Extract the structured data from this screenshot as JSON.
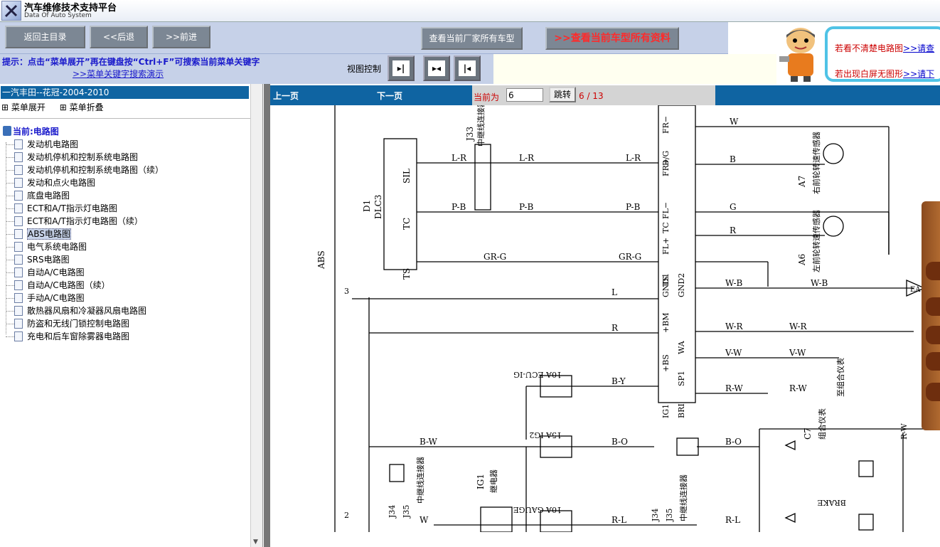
{
  "header": {
    "title": "汽车维修技术支持平台",
    "subtitle": "Data Of Auto System"
  },
  "toolbar": {
    "home_label": "返回主目录",
    "back_label": "<<后退",
    "forward_label": ">>前进",
    "all_models_label": "查看当前厂家所有车型",
    "all_data_label": ">>查看当前车型所有资料"
  },
  "hint": {
    "text": "提示：点击“菜单展开”再在键盘按“Ctrl+F”可搜索当前菜单关键字",
    "link": ">>菜单关键字搜索演示",
    "view_control": "视图控制"
  },
  "notices": {
    "line1_text": "若看不清楚电路图",
    "line1_link": ">>请查",
    "line2_text": "若出现白屏无图形",
    "line2_link": ">>请下"
  },
  "sidebar": {
    "car_title": "一汽丰田--花冠-2004-2010",
    "expand_label": "菜单展开",
    "collapse_label": "菜单折叠",
    "root_label": "当前:电路图",
    "items": [
      {
        "label": "发动机电路图"
      },
      {
        "label": "发动机停机和控制系统电路图"
      },
      {
        "label": "发动机停机和控制系统电路图（续）"
      },
      {
        "label": "发动和点火电路图"
      },
      {
        "label": "底盘电路图"
      },
      {
        "label": "ECT和A/T指示灯电路图"
      },
      {
        "label": "ECT和A/T指示灯电路图（续）"
      },
      {
        "label": "ABS电路图"
      },
      {
        "label": "电气系统电路图"
      },
      {
        "label": "SRS电路图"
      },
      {
        "label": "自动A/C电路图"
      },
      {
        "label": "自动A/C电路图（续）"
      },
      {
        "label": "手动A/C电路图"
      },
      {
        "label": "散热器风扇和冷凝器风扇电路图"
      },
      {
        "label": "防盗和无线门锁控制电路图"
      },
      {
        "label": "充电和后车窗除雾器电路图"
      }
    ]
  },
  "pager": {
    "prev_label": "上一页",
    "next_label": "下一页",
    "current_label": "当前为",
    "current_value": "6",
    "jump_label": "跳转",
    "page_count": "6 / 13"
  },
  "diagram": {
    "labels": {
      "abs": "ABS",
      "dlc3_id": "D1",
      "dlc3": "DLC3",
      "j33": "J33",
      "j33_desc": "中继线连接器",
      "a7": "A7",
      "a7_desc": "右前轮转速传感器",
      "a6": "A6",
      "a6_desc": "左前轮转速传感器",
      "fuse_ecu": "10A ECU-IG",
      "fuse_ig2": "15A IG2",
      "fuse_gauge": "10A GAUGE",
      "ig1": "IG1",
      "ig1_desc": "继电器",
      "j34": "J34",
      "j35": "J35",
      "relay_desc": "中继线连接器",
      "c7": "C7",
      "c7_desc": "组合仪表",
      "meter_desc": "至组合仪表",
      "brake": "BRAKE",
      "ea": "EA",
      "sil": "SIL",
      "tc": "TC",
      "ts": "TS",
      "pins_right": [
        "FR−",
        "FR+",
        "FL−",
        "FL+",
        "GND1",
        "GND2",
        "+BM",
        "+BS",
        "WA",
        "SP1",
        "BRI",
        "IG1",
        "TS",
        "TC",
        "D/G",
        "S"
      ],
      "wires": [
        "L-R",
        "P-B",
        "GR-G",
        "W-B",
        "W-R",
        "V-W",
        "R-W",
        "B-Y",
        "B-O",
        "R-L",
        "B-W",
        "W",
        "B",
        "G",
        "R",
        "L"
      ]
    }
  }
}
